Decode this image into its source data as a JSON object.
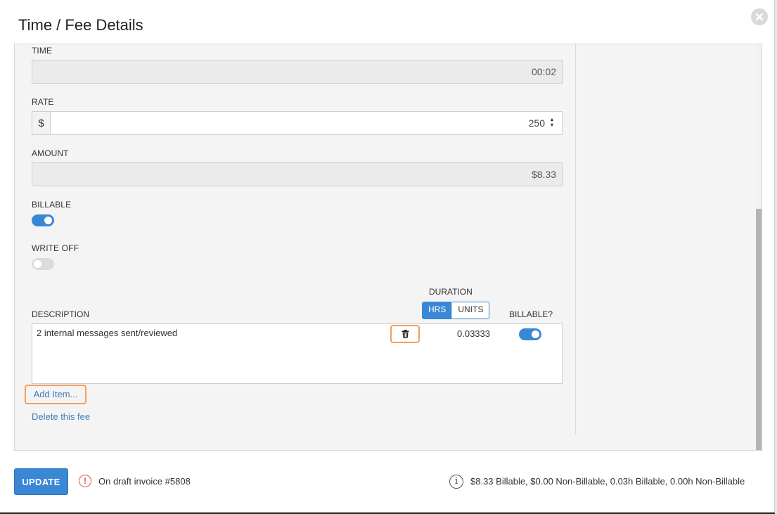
{
  "modal": {
    "title": "Time / Fee Details",
    "close_icon": "close-circle-icon"
  },
  "form": {
    "time": {
      "label": "TIME",
      "value": "00:02"
    },
    "rate": {
      "label": "RATE",
      "currency_symbol": "$",
      "value": "250"
    },
    "amount": {
      "label": "AMOUNT",
      "value": "$8.33"
    },
    "billable": {
      "label": "BILLABLE",
      "on": true
    },
    "write_off": {
      "label": "WRITE OFF",
      "on": false
    }
  },
  "items": {
    "description_header": "DESCRIPTION",
    "duration_header": "DURATION",
    "billable_header": "BILLABLE?",
    "duration_modes": [
      "HRS",
      "UNITS"
    ],
    "active_mode": "HRS",
    "rows": [
      {
        "description": "2 internal messages sent/reviewed",
        "duration": "0.03333",
        "billable": true
      }
    ],
    "add_item_label": "Add Item...",
    "delete_fee_label": "Delete this fee"
  },
  "footer": {
    "update_label": "UPDATE",
    "draft_notice": "On draft invoice #5808",
    "summary": "$8.33 Billable, $0.00 Non-Billable, 0.03h Billable, 0.00h Non-Billable"
  },
  "colors": {
    "accent": "#3a87d6",
    "highlight": "#f0a060",
    "warning": "#e0534d",
    "link": "#3a7bbd"
  }
}
